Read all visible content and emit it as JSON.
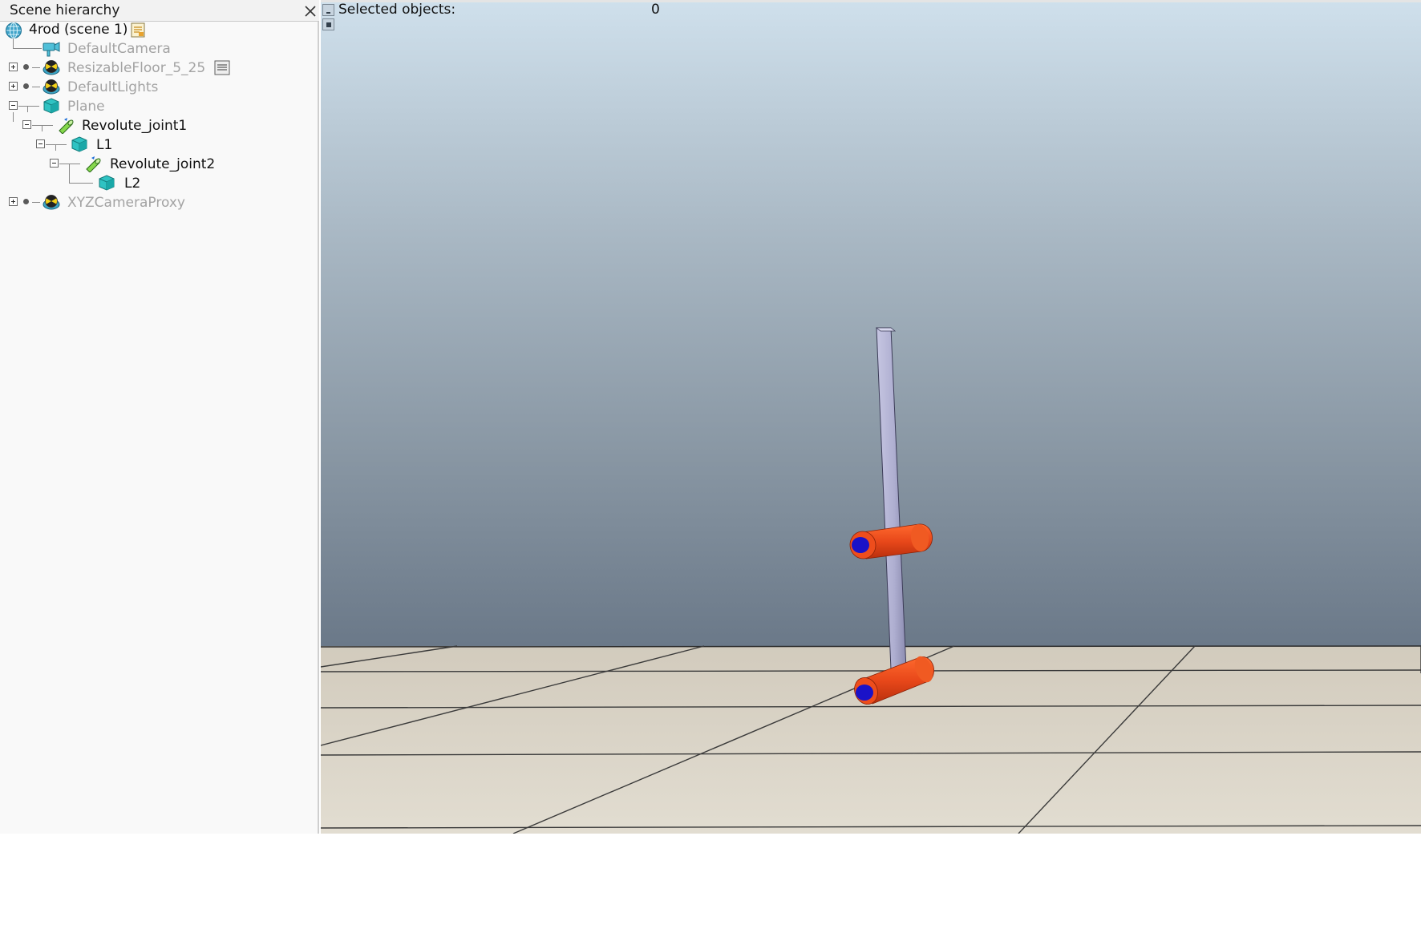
{
  "hierarchy": {
    "title": "Scene hierarchy",
    "items": [
      {
        "label": "4rod (scene 1)",
        "icon": "scene-globe-icon"
      },
      {
        "label": "DefaultCamera",
        "icon": "camera-icon"
      },
      {
        "label": "ResizableFloor_5_25",
        "icon": "model-icon"
      },
      {
        "label": "DefaultLights",
        "icon": "model-icon"
      },
      {
        "label": "Plane",
        "icon": "shape-cube-icon"
      },
      {
        "label": "Revolute_joint1",
        "icon": "revolute-joint-icon"
      },
      {
        "label": "L1",
        "icon": "shape-cube-icon"
      },
      {
        "label": "Revolute_joint2",
        "icon": "revolute-joint-icon"
      },
      {
        "label": "L2",
        "icon": "shape-cube-icon"
      },
      {
        "label": "XYZCameraProxy",
        "icon": "model-icon"
      }
    ]
  },
  "viewport": {
    "selected_label": "Selected objects:",
    "selected_count": "0"
  },
  "colors": {
    "joint_orange": "#e8481a",
    "joint_axis_blue": "#1a12c8",
    "link_lavender": "#b4b4d6",
    "floor_tile": "#ddd6c8",
    "sky_top": "#cfe0ec",
    "sky_bottom": "#5d6a79"
  }
}
